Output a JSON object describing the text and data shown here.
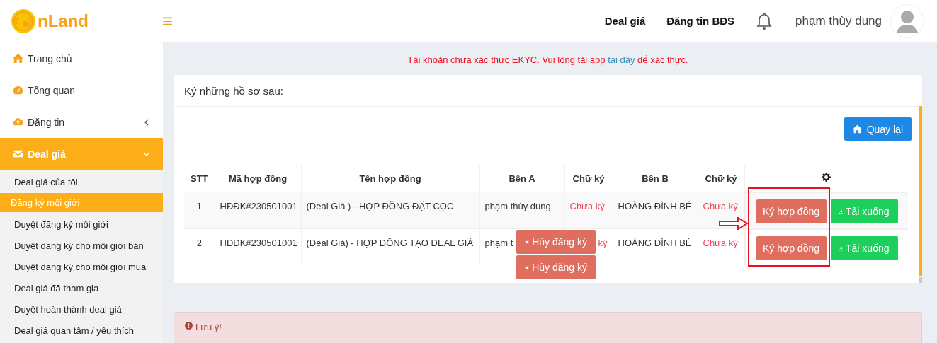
{
  "header": {
    "logo_text": "nLand",
    "nav": [
      {
        "label": "Deal giá"
      },
      {
        "label": "Đăng tin BĐS"
      }
    ],
    "user_name": "phạm thùy dung"
  },
  "sidebar": {
    "items": [
      {
        "label": "Trang chủ",
        "kind": "link",
        "selected": false
      },
      {
        "label": "Tổng quan",
        "kind": "link",
        "selected": false
      },
      {
        "label": "Đăng tin",
        "kind": "group",
        "expanded": false,
        "selected": false
      },
      {
        "label": "Deal giá",
        "kind": "group",
        "expanded": true,
        "selected": true,
        "children": [
          {
            "label": "Deal giá của tôi",
            "selected": false
          },
          {
            "label": "Đăng ký môi giới",
            "selected": true
          },
          {
            "label": "Duyệt đăng ký môi giới",
            "selected": false
          },
          {
            "label": "Duyệt đăng ký cho môi giới bán",
            "selected": false
          },
          {
            "label": "Duyệt đăng ký cho môi giới mua",
            "selected": false
          },
          {
            "label": "Deal giá đã tham gia",
            "selected": false
          },
          {
            "label": "Duyệt hoàn thành deal giá",
            "selected": false
          },
          {
            "label": "Deal giá quan tâm / yêu thích",
            "selected": false
          }
        ]
      }
    ]
  },
  "notice": {
    "before": "Tài khoản chưa xác thực EKYC. Vui lòng tải app ",
    "link": "tại đây",
    "after": " để xác thực."
  },
  "card": {
    "title": "Ký những hồ sơ sau:",
    "back_button": "Quay lại",
    "table": {
      "columns": [
        "STT",
        "Mã hợp đồng",
        "Tên hợp đồng",
        "Bên A",
        "Chữ ký",
        "Bên B",
        "Chữ ký"
      ],
      "rows": [
        {
          "stt": "1",
          "code": "HĐĐK#230501001",
          "name": "(Deal Giá ) - HỢP ĐỒNG ĐẶT CỌC",
          "party_a": "phạm thùy dung",
          "sign_a": {
            "text": "Chưa ký",
            "signed": false
          },
          "party_b": "HOÀNG ĐÌNH BÉ",
          "sign_b": {
            "text": "Chưa ký",
            "signed": false
          },
          "sign_button": "Ký hợp đồng",
          "download_button": "Tải xuống"
        },
        {
          "stt": "2",
          "code": "HĐĐK#230501001",
          "name": "(Deal Giá) - HỢP ĐỒNG TẠO DEAL GIÁ",
          "party_a": "phạm t",
          "sign_a": {
            "text": "ký",
            "signed": false
          },
          "party_b": "HOÀNG ĐÌNH BÉ",
          "sign_b": {
            "text": "Chưa ký",
            "signed": false
          },
          "sign_button": "Ký hợp đồng",
          "download_button": "Tải xuống"
        }
      ]
    },
    "popup_buttons": [
      "Hủy đăng ký",
      "Hủy đăng ký"
    ]
  },
  "alert": {
    "title": "Lưu ý!"
  }
}
